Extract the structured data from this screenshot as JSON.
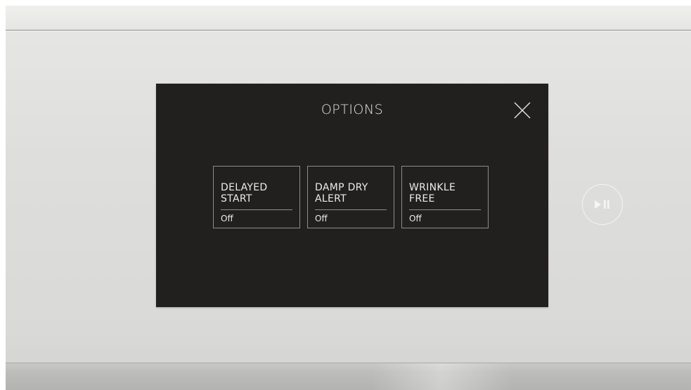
{
  "screen": {
    "title": "OPTIONS",
    "close_icon": "close-icon",
    "options": [
      {
        "label_lines": [
          "DELAYED",
          "START"
        ],
        "value": "Off"
      },
      {
        "label_lines": [
          "DAMP DRY",
          "ALERT"
        ],
        "value": "Off"
      },
      {
        "label_lines": [
          "WRINKLE",
          "FREE"
        ],
        "value": "Off"
      }
    ]
  },
  "controls": {
    "play_pause_icon": "play-pause-icon"
  },
  "colors": {
    "screen_background": "#21201e",
    "text": "#ecebe9",
    "tile_border": "#8d8c89",
    "panel": "#dededc"
  }
}
